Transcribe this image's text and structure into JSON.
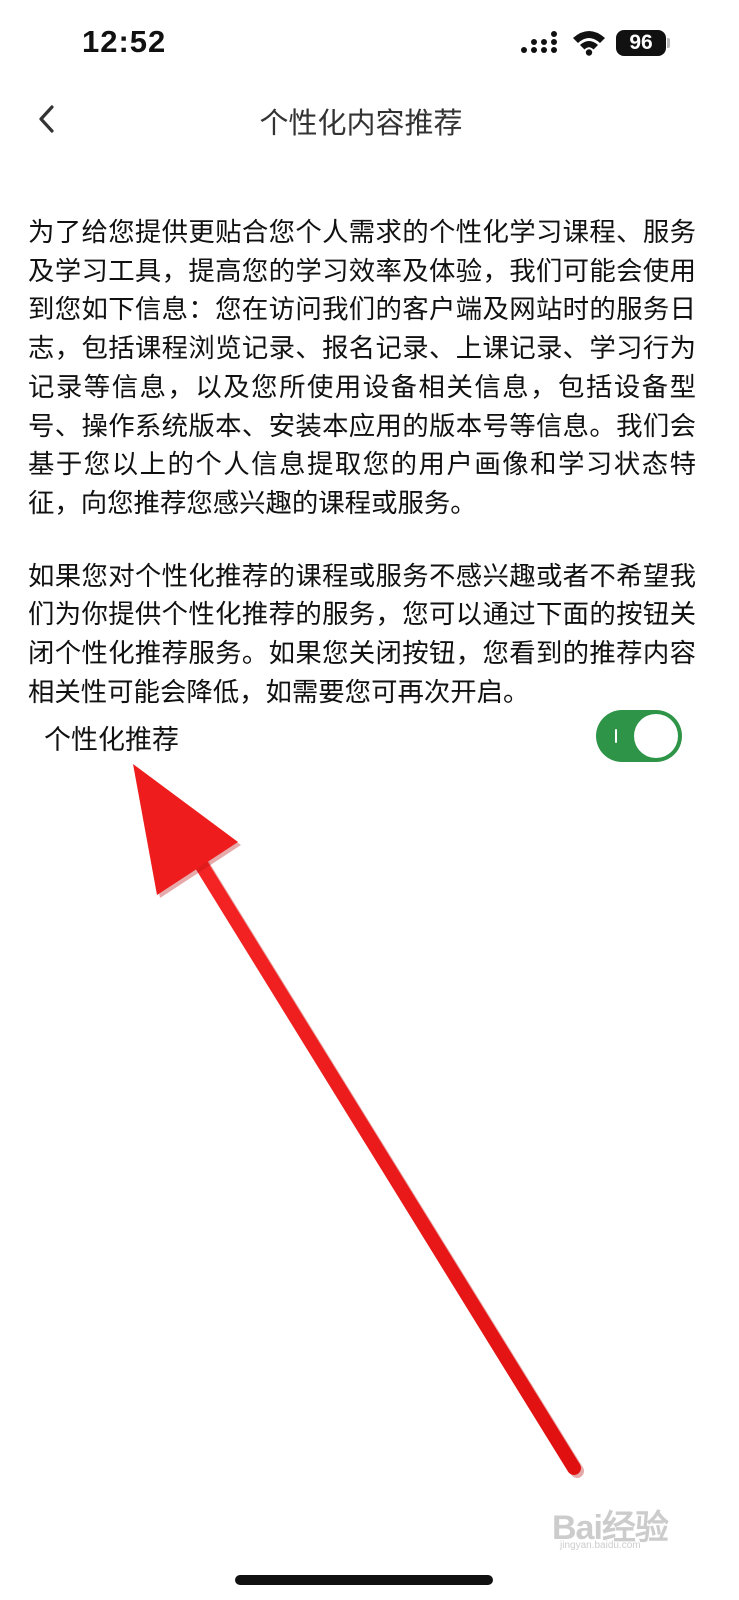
{
  "status_bar": {
    "time": "12:52",
    "battery": "96",
    "icons": [
      "signal-icon",
      "wifi-icon",
      "battery-icon"
    ]
  },
  "nav": {
    "back_icon": "chevron-left-icon",
    "title": "个性化内容推荐"
  },
  "content": {
    "paragraphs": [
      "为了给您提供更贴合您个人需求的个性化学习课程、服务及学习工具，提高您的学习效率及体验，我们可能会使用到您如下信息：您在访问我们的客户端及网站时的服务日志，包括课程浏览记录、报名记录、上课记录、学习行为记录等信息，以及您所使用设备相关信息，包括设备型号、操作系统版本、安装本应用的版本号等信息。我们会基于您以上的个人信息提取您的用户画像和学习状态特征，向您推荐您感兴趣的课程或服务。",
      "如果您对个性化推荐的课程或服务不感兴趣或者不希望我们为你提供个性化推荐的服务，您可以通过下面的按钮关闭个性化推荐服务。如果您关闭按钮，您看到的推荐内容相关性可能会降低，如需要您可再次开启。"
    ]
  },
  "setting": {
    "label": "个性化推荐",
    "enabled": true
  },
  "colors": {
    "toggle_on": "#2e9447",
    "annotation_arrow": "#ee1c1c",
    "text": "#111111"
  },
  "watermark": {
    "brand": "Bai经验",
    "url": "jingyan.baidu.com"
  }
}
